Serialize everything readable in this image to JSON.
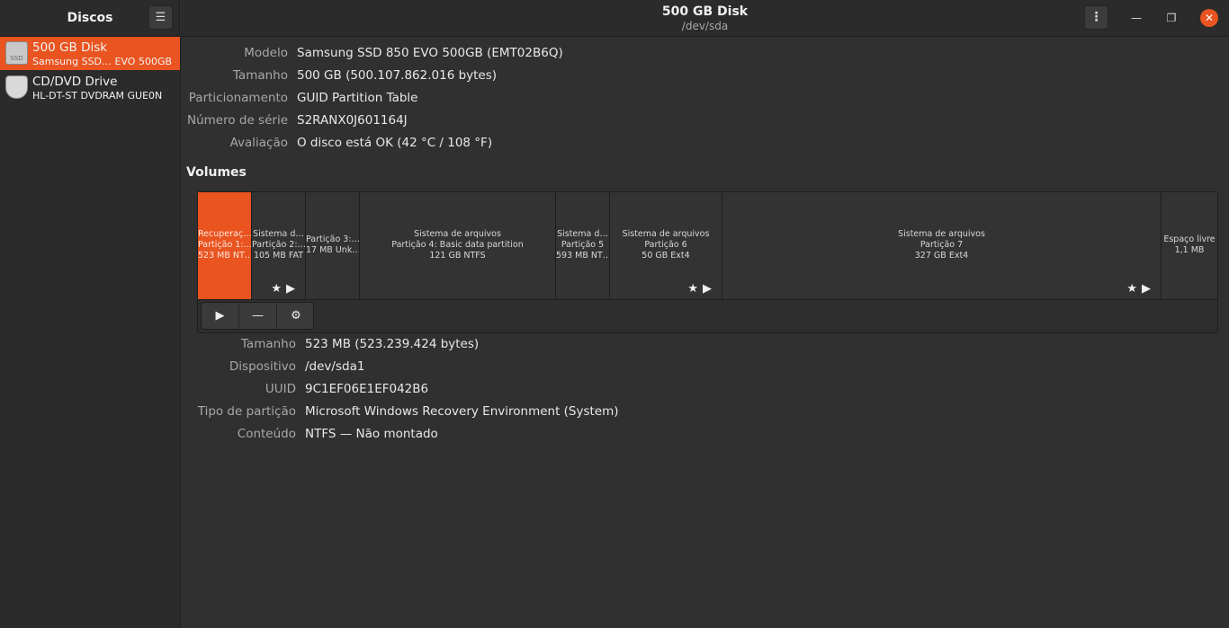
{
  "sidebar": {
    "title": "Discos",
    "menu_icon": "hamburger-icon",
    "items": [
      {
        "name": "500 GB Disk",
        "subtitle": "Samsung SSD… EVO 500GB",
        "icon": "ssd-icon",
        "icon_label": "SSD",
        "selected": true
      },
      {
        "name": "CD/DVD Drive",
        "subtitle": "HL-DT-ST DVDRAM GUE0N",
        "icon": "optical-drive-icon",
        "selected": false
      }
    ]
  },
  "header": {
    "title": "500 GB Disk",
    "subtitle": "/dev/sda",
    "menu_icon": "vertical-dots-icon",
    "minimize_icon": "minimize-icon",
    "maximize_icon": "maximize-icon",
    "close_icon": "close-icon"
  },
  "disk_info": {
    "rows": [
      {
        "label": "Modelo",
        "value": "Samsung SSD 850 EVO 500GB (EMT02B6Q)"
      },
      {
        "label": "Tamanho",
        "value": "500 GB (500.107.862.016 bytes)"
      },
      {
        "label": "Particionamento",
        "value": "GUID Partition Table"
      },
      {
        "label": "Número de série",
        "value": "S2RANX0J601164J"
      },
      {
        "label": "Avaliação",
        "value": "O disco está OK (42 °C / 108 °F)"
      }
    ]
  },
  "volumes": {
    "title": "Volumes",
    "segments": [
      {
        "lines": [
          "Recuperaç…",
          "Partição 1:…",
          "523 MB NT…"
        ],
        "selected": true,
        "icons": ""
      },
      {
        "lines": [
          "Sistema d…",
          "Partição 2:…",
          "105 MB FAT"
        ],
        "selected": false,
        "icons": "★▶"
      },
      {
        "lines": [
          "Partição 3:…",
          "17 MB Unk…"
        ],
        "selected": false,
        "icons": ""
      },
      {
        "lines": [
          "Sistema de arquivos",
          "Partição 4: Basic data partition",
          "121 GB NTFS"
        ],
        "selected": false,
        "icons": ""
      },
      {
        "lines": [
          "Sistema d…",
          "Partição 5",
          "593 MB NT…"
        ],
        "selected": false,
        "icons": ""
      },
      {
        "lines": [
          "Sistema de arquivos",
          "Partição 6",
          "50 GB Ext4"
        ],
        "selected": false,
        "icons": "★▶"
      },
      {
        "lines": [
          "Sistema de arquivos",
          "Partição 7",
          "327 GB Ext4"
        ],
        "selected": false,
        "icons": "★▶"
      },
      {
        "lines": [
          "Espaço livre",
          "1,1 MB"
        ],
        "selected": false,
        "icons": ""
      }
    ],
    "toolbar": {
      "mount_icon": "play-icon",
      "delete_icon": "minus-icon",
      "settings_icon": "gears-icon"
    }
  },
  "partition_info": {
    "rows": [
      {
        "label": "Tamanho",
        "value": "523 MB (523.239.424 bytes)"
      },
      {
        "label": "Dispositivo",
        "value": "/dev/sda1"
      },
      {
        "label": "UUID",
        "value": "9C1EF06E1EF042B6"
      },
      {
        "label": "Tipo de partição",
        "value": "Microsoft Windows Recovery Environment (System)"
      },
      {
        "label": "Conteúdo",
        "value": "NTFS — Não montado"
      }
    ]
  },
  "colors": {
    "accent": "#e95420",
    "background": "#303030",
    "sidebar": "#2b2b2b"
  }
}
